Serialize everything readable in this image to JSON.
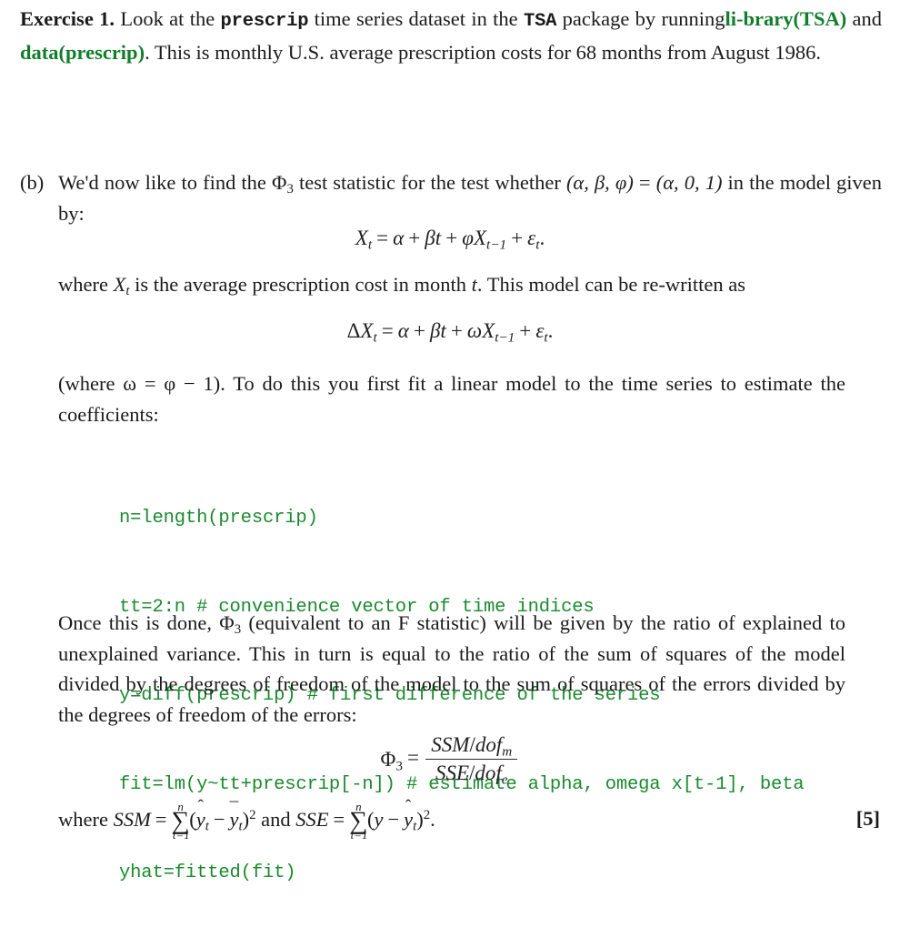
{
  "document": {
    "type": "exercise-sheet",
    "colors": {
      "body_text": "#1b1b1b",
      "code_green": "#1a8a2e",
      "link_green": "#137d2c",
      "inline_code": "#1b1b1b"
    }
  },
  "exercise": {
    "heading": "Exercise 1.",
    "text_1": "Look at the",
    "code_1": "prescrip",
    "text_2": "time series dataset in the",
    "code_2": "TSA",
    "text_3": "package by running",
    "link_1": "library(TSA)",
    "link_1_part_a": "li-",
    "link_1_part_b": "brary(TSA)",
    "text_4": "and",
    "link_2": "data(prescrip)",
    "text_5": ". This is monthly U.S. average prescription costs for 68 months from August 1986."
  },
  "item_b": {
    "marker": "(b)",
    "para_1_before": "We'd now like to find the",
    "phi_symbol": "Φ",
    "phi_sub": "3",
    "para_1_mid": "test statistic for the test whether",
    "tuple_left": "(α, β, φ)",
    "equals": "=",
    "tuple_right": "(α, 0, 1)",
    "para_1_after": "in the model given by:"
  },
  "equations": {
    "model": {
      "lhs_var": "X",
      "lhs_sub": "t",
      "eq": "=",
      "alpha": "α",
      "plus": "+",
      "beta": "β",
      "t": "t",
      "phi": "φ",
      "x_lag": "X",
      "x_lag_sub": "t−1",
      "epsilon": "ε",
      "epsilon_sub": "t",
      "period": "."
    },
    "difference": {
      "delta": "Δ",
      "lhs_var": "X",
      "lhs_sub": "t",
      "eq": "=",
      "alpha": "α",
      "plus": "+",
      "beta": "β",
      "t": "t",
      "omega": "ω",
      "x_lag": "X",
      "x_lag_sub": "t−1",
      "epsilon": "ε",
      "epsilon_sub": "t",
      "period": "."
    },
    "phi3_fraction": {
      "lhs": "Φ",
      "lhs_sub": "3",
      "eq": "=",
      "numerator_a": "SSM",
      "numerator_slash": "/",
      "numerator_b": "dof",
      "numerator_b_sub": "m",
      "denominator_a": "SSE",
      "denominator_slash": "/",
      "denominator_b": "dof",
      "denominator_b_sub": "e"
    }
  },
  "paragraphs": {
    "where_xt": {
      "before": "where",
      "var": "X",
      "var_sub": "t",
      "mid": "is the average prescription cost in month",
      "month_var": "t",
      "after": ". This model can be re-written as"
    },
    "where_omega": {
      "text": "(where ω = φ − 1). To do this you first fit a linear model to the time series to estimate the coefficients:"
    },
    "once_done": {
      "before": "Once this is done,",
      "phi": "Φ",
      "phi_sub": "3",
      "after": "(equivalent to an F statistic) will be given by the ratio of explained to unexplained variance. This in turn is equal to the ratio of the sum of squares of the model divided by the degrees of freedom of the model to the sum of squares of the errors divided by the degrees of freedom of the errors:"
    }
  },
  "code_block": {
    "language": "R",
    "lines": [
      "n=length(prescrip)",
      "tt=2:n # convenience vector of time indices",
      "y=diff(prescrip) # first difference of the series",
      "fit=lm(y~tt+prescrip[-n]) # estimate alpha, omega x[t-1], beta",
      "yhat=fitted(fit)"
    ]
  },
  "where_line": {
    "where": "where",
    "ssm": "SSM",
    "eq1": "=",
    "sum_glyph": "∑",
    "sum_upper": "n",
    "sum_lower": "t=1",
    "ssm_body_open": "(",
    "ssm_yhat": "y",
    "ssm_hat": "ˆ",
    "ssm_yhat_sub": "t",
    "ssm_minus": "−",
    "ssm_ybar": "y",
    "ssm_bar": "¯",
    "ssm_ybar_sub": "t",
    "ssm_body_close": ")",
    "ssm_power": "2",
    "and": "and",
    "sse": "SSE",
    "eq2": "=",
    "sse_body_open": "(",
    "sse_y": "y",
    "sse_minus": "−",
    "sse_yhat": "y",
    "sse_hat": "ˆ",
    "sse_yhat_sub": "t",
    "sse_body_close": ")",
    "sse_power": "2",
    "period": "."
  },
  "marks": {
    "value": "[5]"
  }
}
